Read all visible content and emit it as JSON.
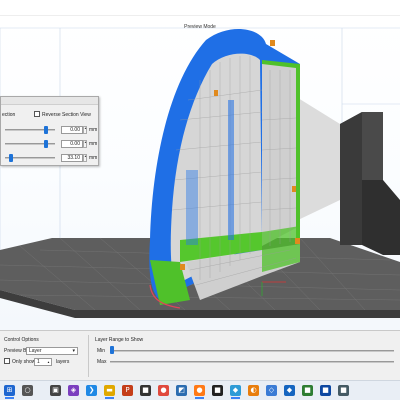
{
  "viewport": {
    "mode_label": "Preview Mode"
  },
  "section_panel": {
    "title_fragment": "ection",
    "reverse_label": "Reverse Section View",
    "reverse_checked": false,
    "rows": [
      {
        "value": "0.00",
        "unit": "mm",
        "slider_fraction": 0.85
      },
      {
        "value": "0.00",
        "unit": "mm",
        "slider_fraction": 0.85
      },
      {
        "value": "33.10",
        "unit": "mm",
        "slider_fraction": 0.08
      }
    ]
  },
  "controls": {
    "left_title": "Control Options",
    "preview_by_label": "Preview By",
    "preview_by_value": "Layer",
    "only_show_label": "Only show",
    "only_show_value": "1",
    "layers_label": "layers",
    "right_title": "Layer Range to Show",
    "min_label": "Min",
    "max_label": "Max",
    "min_fraction": 0.0
  },
  "taskbar": {
    "icons": [
      {
        "name": "start-icon",
        "glyph": "⊞",
        "color": "#1e66d0",
        "active": true
      },
      {
        "name": "search-icon",
        "glyph": "○",
        "color": "#555555",
        "active": false
      },
      {
        "name": "task-view-icon",
        "glyph": "▣",
        "color": "#444444",
        "active": false
      },
      {
        "name": "visual-studio-icon",
        "glyph": "◈",
        "color": "#7b3fbf",
        "active": false
      },
      {
        "name": "vscode-icon",
        "glyph": "❯",
        "color": "#1e88e5",
        "active": false
      },
      {
        "name": "file-explorer-icon",
        "glyph": "▬",
        "color": "#e0a800",
        "active": true
      },
      {
        "name": "powerpoint-icon",
        "glyph": "P",
        "color": "#c43e1c",
        "active": false
      },
      {
        "name": "dark-app-icon",
        "glyph": "■",
        "color": "#333333",
        "active": false
      },
      {
        "name": "chrome-icon",
        "glyph": "●",
        "color": "#e04a3f",
        "active": false
      },
      {
        "name": "photos-icon",
        "glyph": "◩",
        "color": "#2b6cb0",
        "active": false
      },
      {
        "name": "firefox-icon",
        "glyph": "●",
        "color": "#ff7a18",
        "active": true
      },
      {
        "name": "terminal-icon",
        "glyph": "■",
        "color": "#222222",
        "active": false
      },
      {
        "name": "slicer-app-icon",
        "glyph": "◆",
        "color": "#2e9bd6",
        "active": true
      },
      {
        "name": "blender-icon",
        "glyph": "◐",
        "color": "#e87d0d",
        "active": false
      },
      {
        "name": "app-icon-15",
        "glyph": "◇",
        "color": "#3a7bd5",
        "active": false
      },
      {
        "name": "app-icon-16",
        "glyph": "◆",
        "color": "#1565c0",
        "active": false
      },
      {
        "name": "app-icon-17",
        "glyph": "■",
        "color": "#2e7d32",
        "active": false
      },
      {
        "name": "app-icon-18",
        "glyph": "■",
        "color": "#0d47a1",
        "active": false
      },
      {
        "name": "app-icon-19",
        "glyph": "■",
        "color": "#455a64",
        "active": false
      }
    ]
  },
  "colors": {
    "shell": "#1e6fe8",
    "infill": "#d9d9d9",
    "support": "#5bd12f",
    "accent": "#e08a1e",
    "bed": "#5c5c5c"
  }
}
